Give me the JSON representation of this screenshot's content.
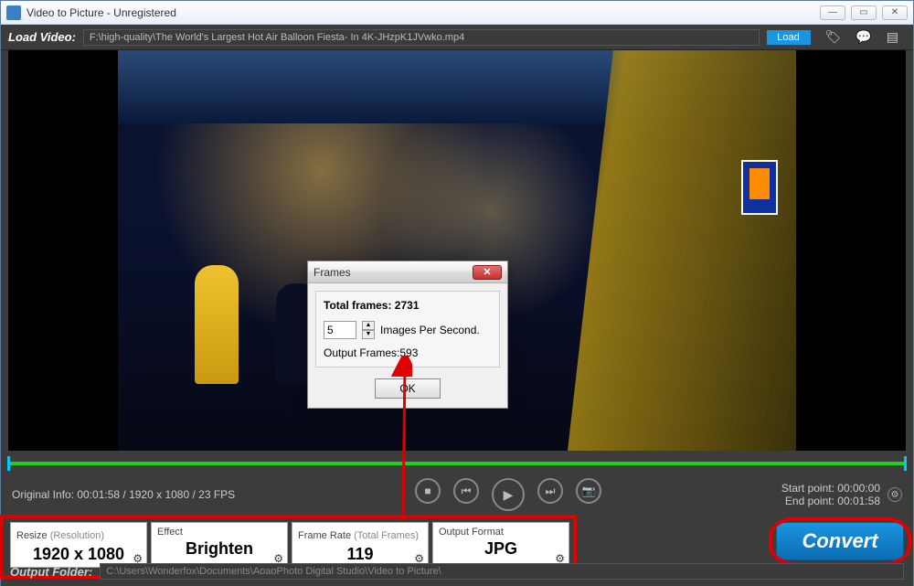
{
  "window": {
    "title": "Video to Picture - Unregistered"
  },
  "toolbar": {
    "load_label": "Load Video:",
    "path": "F:\\high-quality\\The World's Largest Hot Air Balloon Fiesta- In 4K-JHzpK1JVwko.mp4",
    "load_button": "Load"
  },
  "stage": {
    "original_info": "Original Info: 00:01:58 / 1920 x 1080 / 23 FPS",
    "start_label": "Start point:",
    "start_value": "00:00:00",
    "end_label": "End point:",
    "end_value": "00:01:58"
  },
  "cards": {
    "resize": {
      "label": "Resize ",
      "sub": "(Resolution)",
      "value": "1920 x 1080"
    },
    "effect": {
      "label": "Effect",
      "value": "Brighten"
    },
    "framerate": {
      "label": "Frame Rate ",
      "sub": "(Total Frames)",
      "value": "119"
    },
    "format": {
      "label": "Output Format",
      "value": "JPG"
    }
  },
  "convert": {
    "label": "Convert"
  },
  "output": {
    "label": "Output Folder:",
    "path": "C:\\Users\\Wonderfox\\Documents\\AoaoPhoto Digital Studio\\Video to Picture\\"
  },
  "dialog": {
    "title": "Frames",
    "total_label": "Total frames: ",
    "total_value": "2731",
    "fps_value": "5",
    "fps_label": "Images Per Second.",
    "output_label": "Output Frames:",
    "output_value": "593",
    "ok": "OK"
  }
}
